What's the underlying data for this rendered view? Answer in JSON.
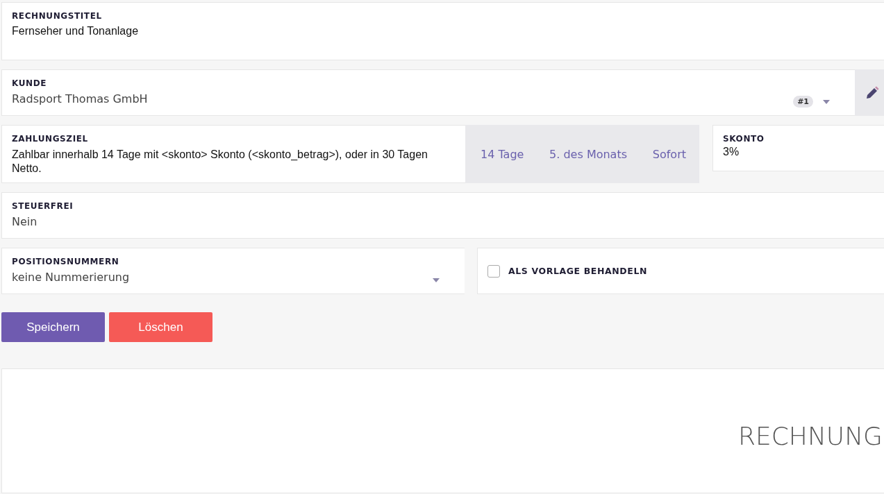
{
  "title_field": {
    "label": "RECHNUNGSTITEL",
    "value": "Fernseher und Tonanlage"
  },
  "customer_field": {
    "label": "KUNDE",
    "value": "Radsport Thomas GmbH",
    "badge": "#1"
  },
  "payment_terms": {
    "label": "ZAHLUNGSZIEL",
    "value": "Zahlbar innerhalb 14 Tage mit <skonto> Skonto (<skonto_betrag>), oder in 30 Tagen Netto.",
    "presets": [
      "14 Tage",
      "5. des Monats",
      "Sofort"
    ]
  },
  "discount": {
    "label": "SKONTO",
    "value": "3%"
  },
  "tax_free": {
    "label": "STEUERFREI",
    "value": "Nein"
  },
  "position_numbers": {
    "label": "POSITIONSNUMMERN",
    "value": "keine Nummerierung"
  },
  "template_option": {
    "label": "ALS VORLAGE BEHANDELN",
    "checked": false
  },
  "buttons": [
    {
      "label": "Speichern",
      "kind": "primary"
    },
    {
      "label": "Löschen",
      "kind": "danger"
    }
  ],
  "preview": {
    "heading": "RECHNUNG"
  }
}
